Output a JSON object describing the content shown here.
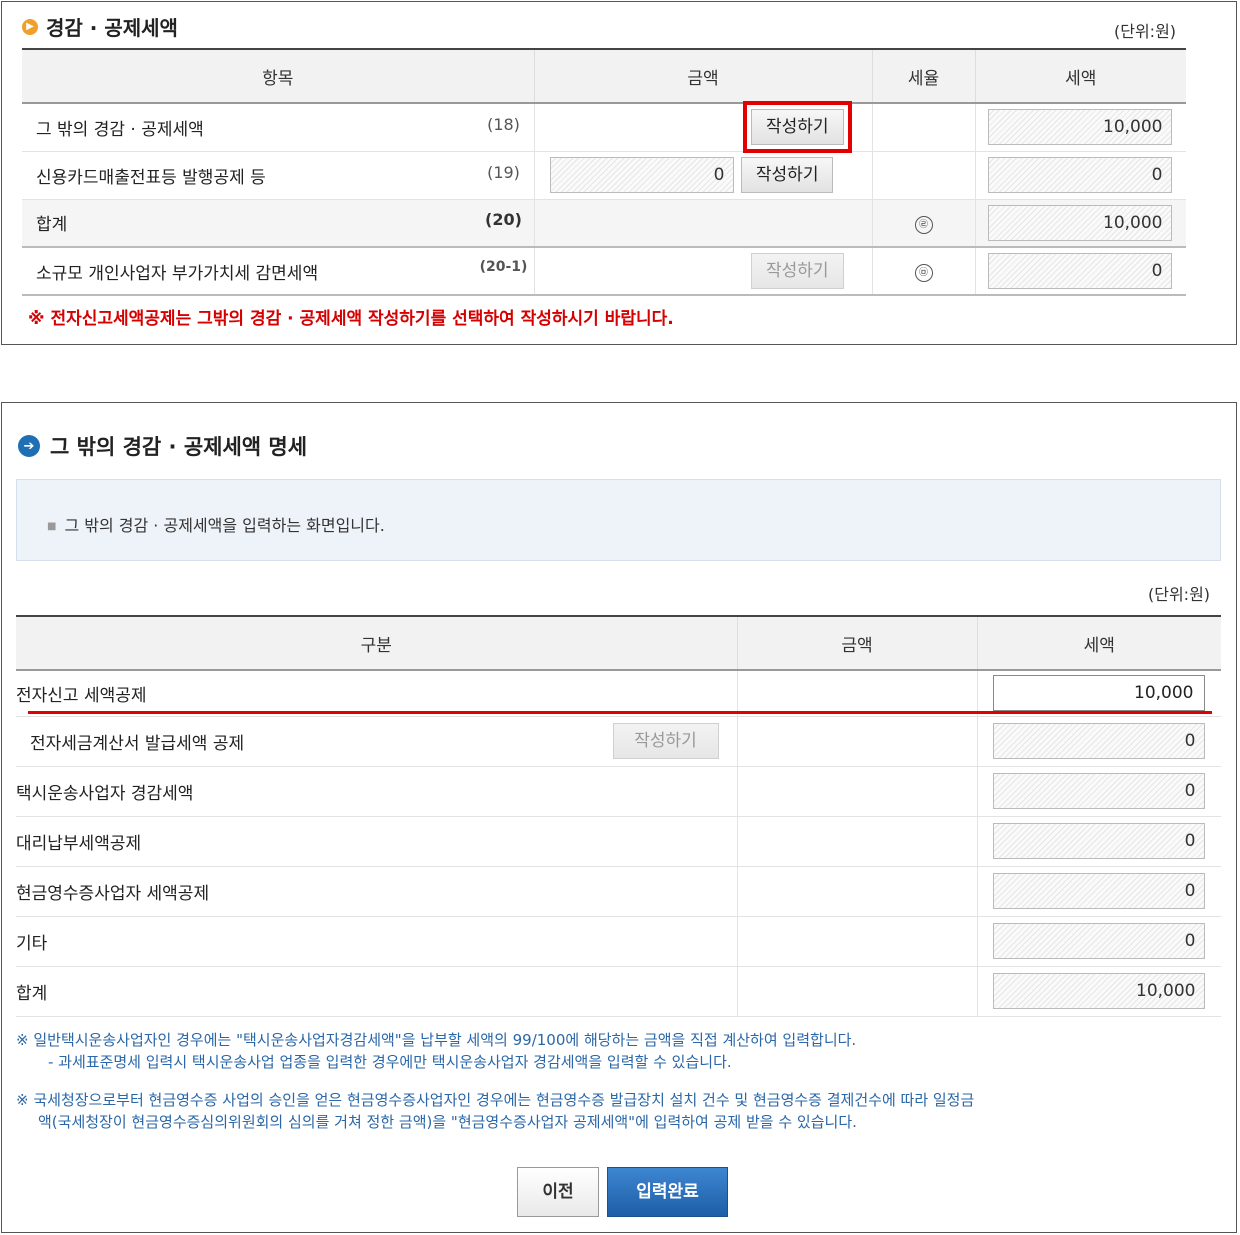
{
  "panel1": {
    "title": "경감 · 공제세액",
    "unit": "(단위:원)",
    "headers": [
      "항목",
      "금액",
      "세율",
      "세액"
    ],
    "rows": [
      {
        "label": "그 밖의 경감 · 공제세액",
        "code": "(18)",
        "amount": "",
        "button": "작성하기",
        "rate": "",
        "tax": "10,000"
      },
      {
        "label": "신용카드매출전표등 발행공제 등",
        "code": "(19)",
        "amount": "0",
        "button": "작성하기",
        "rate": "",
        "tax": "0"
      },
      {
        "label": "합계",
        "code": "(20)",
        "amount": "",
        "button": "",
        "rate": "㉣",
        "tax": "10,000"
      },
      {
        "label": "소규모 개인사업자 부가가치세 감면세액",
        "code": "(20-1)",
        "amount": "",
        "button": "작성하기",
        "rate": "㉤",
        "tax": "0"
      }
    ],
    "notice": "※ 전자신고세액공제는 그밖의 경감 · 공제세액 작성하기를 선택하여 작성하시기 바랍니다."
  },
  "panel2": {
    "title": "그 밖의 경감 · 공제세액 명세",
    "info": "그 밖의 경감 · 공제세액을 입력하는 화면입니다.",
    "unit": "(단위:원)",
    "headers": [
      "구분",
      "금액",
      "세액"
    ],
    "rows": [
      {
        "label": "전자신고 세액공제",
        "button": "",
        "tax": "10,000"
      },
      {
        "label": "전자세금계산서 발급세액 공제",
        "button": "작성하기",
        "tax": "0"
      },
      {
        "label": "택시운송사업자 경감세액",
        "button": "",
        "tax": "0"
      },
      {
        "label": "대리납부세액공제",
        "button": "",
        "tax": "0"
      },
      {
        "label": "현금영수증사업자 세액공제",
        "button": "",
        "tax": "0"
      },
      {
        "label": "기타",
        "button": "",
        "tax": "0"
      },
      {
        "label": "합계",
        "button": "",
        "tax": "10,000"
      }
    ],
    "note1_line1": "일반택시운송사업자인 경우에는 \"택시운송사업자경감세액\"을 납부할 세액의 99/100에 해당하는 금액을 직접 계산하여 입력합니다.",
    "note1_line2": "- 과세표준명세 입력시 택시운송사업 업종을 입력한 경우에만 택시운송사업자 경감세액을 입력할 수 있습니다.",
    "note2_line1": "국세청장으로부터 현금영수증 사업의 승인을 얻은 현금영수증사업자인 경우에는 현금영수증 발급장치 설치 건수 및 현금영수증 결제건수에 따라 일정금",
    "note2_line2": "액(국세청장이 현금영수증심의위원회의 심의를 거쳐 정한 금액)을 \"현금영수증사업자 공제세액\"에 입력하여 공제 받을 수 있습니다.",
    "note_mark": "※",
    "prev_button": "이전",
    "done_button": "입력완료"
  },
  "colors": {
    "highlight": "#e30000",
    "note_text": "#2a67a8",
    "primary_button": "#1f5ea8"
  }
}
